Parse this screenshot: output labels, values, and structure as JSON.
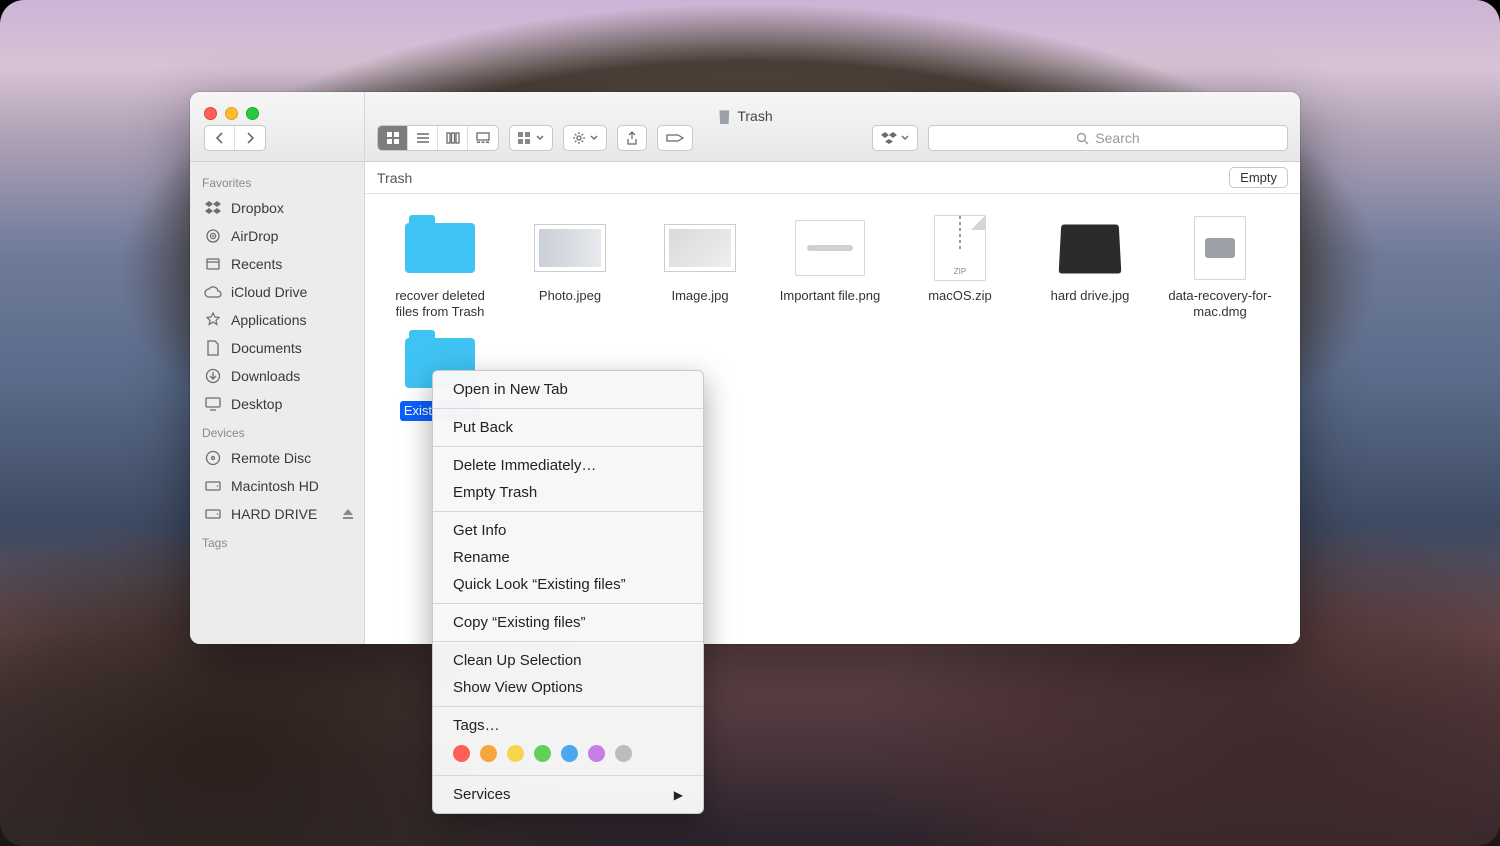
{
  "window": {
    "title": "Trash"
  },
  "toolbar": {
    "search_placeholder": "Search"
  },
  "pathbar": {
    "location": "Trash",
    "empty_label": "Empty"
  },
  "sidebar": {
    "sections": [
      {
        "header": "Favorites",
        "items": [
          {
            "id": "dropbox",
            "label": "Dropbox"
          },
          {
            "id": "airdrop",
            "label": "AirDrop"
          },
          {
            "id": "recents",
            "label": "Recents"
          },
          {
            "id": "icloud-drive",
            "label": "iCloud Drive"
          },
          {
            "id": "applications",
            "label": "Applications"
          },
          {
            "id": "documents",
            "label": "Documents"
          },
          {
            "id": "downloads",
            "label": "Downloads"
          },
          {
            "id": "desktop",
            "label": "Desktop"
          }
        ]
      },
      {
        "header": "Devices",
        "items": [
          {
            "id": "remote-disc",
            "label": "Remote Disc"
          },
          {
            "id": "macintosh-hd",
            "label": "Macintosh HD"
          },
          {
            "id": "hard-drive",
            "label": "HARD DRIVE",
            "eject": true
          }
        ]
      },
      {
        "header": "Tags",
        "items": []
      }
    ]
  },
  "files": [
    {
      "id": "recover-folder",
      "type": "folder",
      "label": "recover deleted files from Trash"
    },
    {
      "id": "photo",
      "type": "image",
      "label": "Photo.jpeg"
    },
    {
      "id": "image",
      "type": "image",
      "label": "Image.jpg"
    },
    {
      "id": "important",
      "type": "png",
      "label": "Important file.png"
    },
    {
      "id": "macos-zip",
      "type": "zip",
      "ziplabel": "ZIP",
      "label": "macOS.zip"
    },
    {
      "id": "harddrive-jpg",
      "type": "hd",
      "label": "hard drive.jpg"
    },
    {
      "id": "dmg",
      "type": "dmg",
      "label": "data-recovery-for-mac.dmg"
    },
    {
      "id": "existing",
      "type": "folder",
      "label": "Existing files",
      "selected": true
    }
  ],
  "context_menu": {
    "items": [
      {
        "label": "Open in New Tab"
      },
      {
        "sep": true
      },
      {
        "label": "Put Back"
      },
      {
        "sep": true
      },
      {
        "label": "Delete Immediately…"
      },
      {
        "label": "Empty Trash"
      },
      {
        "sep": true
      },
      {
        "label": "Get Info"
      },
      {
        "label": "Rename"
      },
      {
        "label": "Quick Look “Existing files”"
      },
      {
        "sep": true
      },
      {
        "label": "Copy “Existing files”"
      },
      {
        "sep": true
      },
      {
        "label": "Clean Up Selection"
      },
      {
        "label": "Show View Options"
      },
      {
        "sep": true
      },
      {
        "label": "Tags…"
      }
    ],
    "tag_colors": [
      "#ff5f56",
      "#f7a43c",
      "#f7d54b",
      "#62cf5b",
      "#4aa7f0",
      "#c57ee6",
      "#bdbdbd"
    ],
    "services_label": "Services"
  }
}
